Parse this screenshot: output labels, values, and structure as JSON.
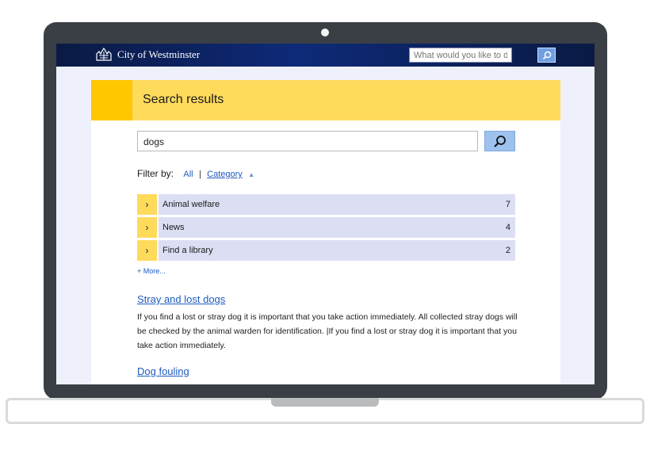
{
  "header": {
    "site_title": "City of Westminster",
    "search_placeholder": "What would you like to do?"
  },
  "page": {
    "title": "Search results"
  },
  "search": {
    "query": "dogs"
  },
  "filter": {
    "label": "Filter by:",
    "all_label": "All",
    "separator": "|",
    "category_label": "Category"
  },
  "categories": [
    {
      "label": "Animal welfare",
      "count": "7"
    },
    {
      "label": "News",
      "count": "4"
    },
    {
      "label": "Find a library",
      "count": "2"
    }
  ],
  "more_label": "+ More...",
  "results": [
    {
      "title": "Stray and lost dogs",
      "summary": "If you find a lost or stray dog it is important that you take action immediately. All collected stray dogs will be checked by the animal warden for identification. |If you find a lost or stray dog it is important that you take action immediately."
    },
    {
      "title": "Dog fouling",
      "summary": ""
    }
  ],
  "colors": {
    "banner_yellow": "#fedb5b",
    "banner_accent": "#fec700",
    "link_blue": "#1e5bbf",
    "category_bg": "#dcdff4",
    "header_navy": "#0e2a78"
  }
}
